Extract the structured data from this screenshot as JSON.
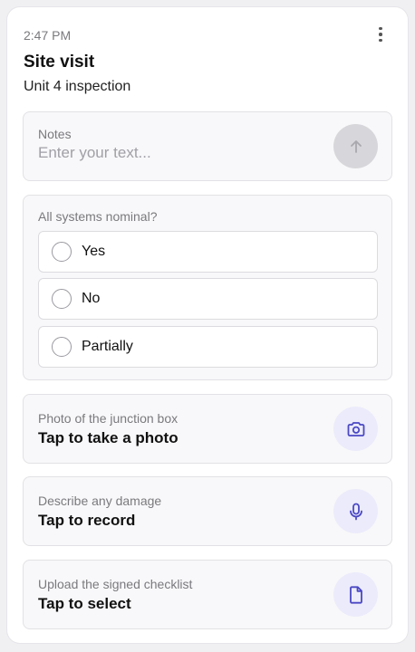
{
  "status_bar": {
    "time": "2:47 PM"
  },
  "header": {
    "title": "Site visit",
    "subtitle": "Unit 4 inspection"
  },
  "notes": {
    "label": "Notes",
    "value": "",
    "placeholder": "Enter your text..."
  },
  "question": {
    "label": "All systems nominal?",
    "options": [
      {
        "label": "Yes",
        "selected": false
      },
      {
        "label": "No",
        "selected": false
      },
      {
        "label": "Partially",
        "selected": false
      }
    ]
  },
  "actions": [
    {
      "label": "Photo of the junction box",
      "value": "Tap to take a photo",
      "icon": "camera-icon"
    },
    {
      "label": "Describe any damage",
      "value": "Tap to record",
      "icon": "microphone-icon"
    },
    {
      "label": "Upload the signed checklist",
      "value": "Tap to select",
      "icon": "document-icon"
    }
  ],
  "colors": {
    "accent": "#4b48c4",
    "icon_bg": "#ebebfb",
    "send_disabled": "#d7d7db",
    "section_bg": "#f8f8fa"
  }
}
